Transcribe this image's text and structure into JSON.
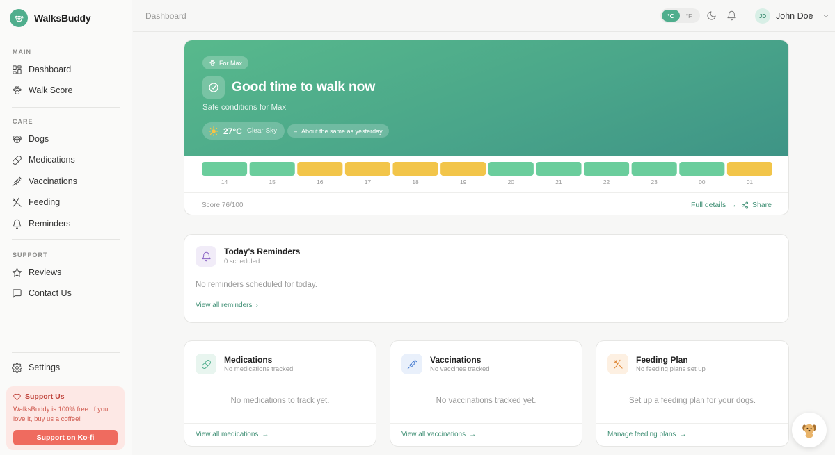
{
  "brand": {
    "name": "WalksBuddy"
  },
  "sidebar": {
    "sections": [
      {
        "label": "MAIN",
        "items": [
          {
            "label": "Dashboard",
            "icon": "dashboard-icon"
          },
          {
            "label": "Walk Score",
            "icon": "paw-icon"
          }
        ]
      },
      {
        "label": "CARE",
        "items": [
          {
            "label": "Dogs",
            "icon": "dog-icon"
          },
          {
            "label": "Medications",
            "icon": "pill-icon"
          },
          {
            "label": "Vaccinations",
            "icon": "syringe-icon"
          },
          {
            "label": "Feeding",
            "icon": "utensils-icon"
          },
          {
            "label": "Reminders",
            "icon": "bell-icon"
          }
        ]
      },
      {
        "label": "SUPPORT",
        "items": [
          {
            "label": "Reviews",
            "icon": "star-icon"
          },
          {
            "label": "Contact Us",
            "icon": "message-icon"
          }
        ]
      }
    ],
    "settings": "Settings",
    "support_box": {
      "title": "Support Us",
      "text": "WalksBuddy is 100% free. If you love it, buy us a coffee!",
      "button": "Support on Ko-fi"
    }
  },
  "topbar": {
    "breadcrumb": "Dashboard",
    "units": {
      "celsius": "°C",
      "fahrenheit": "°F",
      "selected": "°C"
    },
    "user": {
      "initials": "JD",
      "name": "John Doe"
    }
  },
  "hero": {
    "for_label": "For Max",
    "title": "Good time to walk now",
    "subtitle": "Safe conditions for Max",
    "temperature": "27°C",
    "condition": "Clear Sky",
    "trend": "About the same as yesterday",
    "score": "Score 76/100",
    "full_details": "Full details",
    "share": "Share",
    "hours": [
      {
        "label": "14",
        "status": "good"
      },
      {
        "label": "15",
        "status": "good"
      },
      {
        "label": "16",
        "status": "fair"
      },
      {
        "label": "17",
        "status": "fair"
      },
      {
        "label": "18",
        "status": "fair"
      },
      {
        "label": "19",
        "status": "fair"
      },
      {
        "label": "20",
        "status": "good"
      },
      {
        "label": "21",
        "status": "good"
      },
      {
        "label": "22",
        "status": "good"
      },
      {
        "label": "23",
        "status": "good"
      },
      {
        "label": "00",
        "status": "good"
      },
      {
        "label": "01",
        "status": "fair"
      }
    ],
    "colors": {
      "good": "#6acd9c",
      "fair": "#f2c54a"
    }
  },
  "reminders": {
    "title": "Today's Reminders",
    "subtitle": "0 scheduled",
    "empty": "No reminders scheduled for today.",
    "link": "View all reminders"
  },
  "cards": [
    {
      "title": "Medications",
      "subtitle": "No medications tracked",
      "empty": "No medications to track yet.",
      "link": "View all medications",
      "icon": "pill-icon"
    },
    {
      "title": "Vaccinations",
      "subtitle": "No vaccines tracked",
      "empty": "No vaccinations tracked yet.",
      "link": "View all vaccinations",
      "icon": "syringe-icon"
    },
    {
      "title": "Feeding Plan",
      "subtitle": "No feeding plans set up",
      "empty": "Set up a feeding plan for your dogs.",
      "link": "Manage feeding plans",
      "icon": "utensils-icon"
    }
  ]
}
